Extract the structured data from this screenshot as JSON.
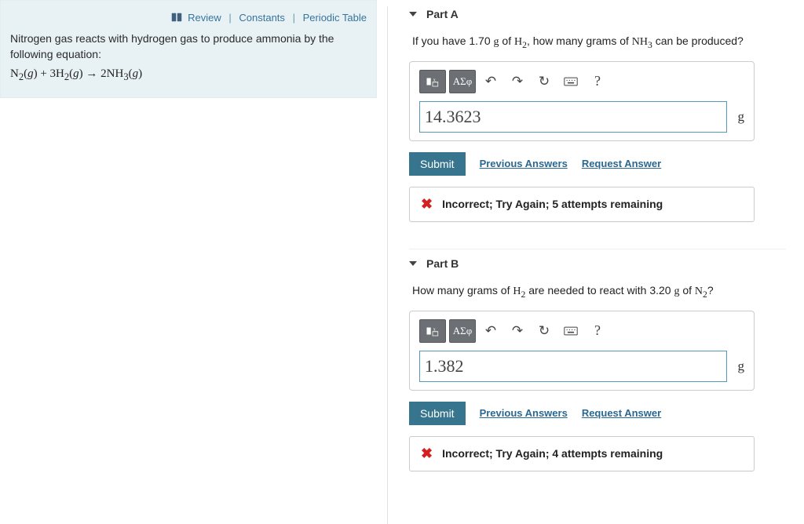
{
  "links": {
    "review": "Review",
    "constants": "Constants",
    "periodic": "Periodic Table"
  },
  "problem": {
    "text": "Nitrogen gas reacts with hydrogen gas to produce ammonia by the following equation:",
    "equation_html": "N<sub>2</sub>(<i>g</i>) + 3H<sub>2</sub>(<i>g</i>) → 2NH<sub>3</sub>(<i>g</i>)"
  },
  "toolbar": {
    "greek": "ΑΣφ",
    "help": "?"
  },
  "actions": {
    "submit": "Submit",
    "previous": "Previous Answers",
    "request": "Request Answer"
  },
  "parts": [
    {
      "label": "Part A",
      "question_html": "If you have 1.70 <span class='serif'>g</span> of <span class='serif'>H<sub>2</sub></span>, how many grams of <span class='serif'>NH<sub>3</sub></span> can be produced?",
      "value": "14.3623",
      "unit": "g",
      "feedback": "Incorrect; Try Again; 5 attempts remaining"
    },
    {
      "label": "Part B",
      "question_html": "How many grams of <span class='serif'>H<sub>2</sub></span> are needed to react with 3.20 <span class='serif'>g</span> of <span class='serif'>N<sub>2</sub></span>?",
      "value": "1.382",
      "unit": "g",
      "feedback": "Incorrect; Try Again; 4 attempts remaining"
    }
  ]
}
